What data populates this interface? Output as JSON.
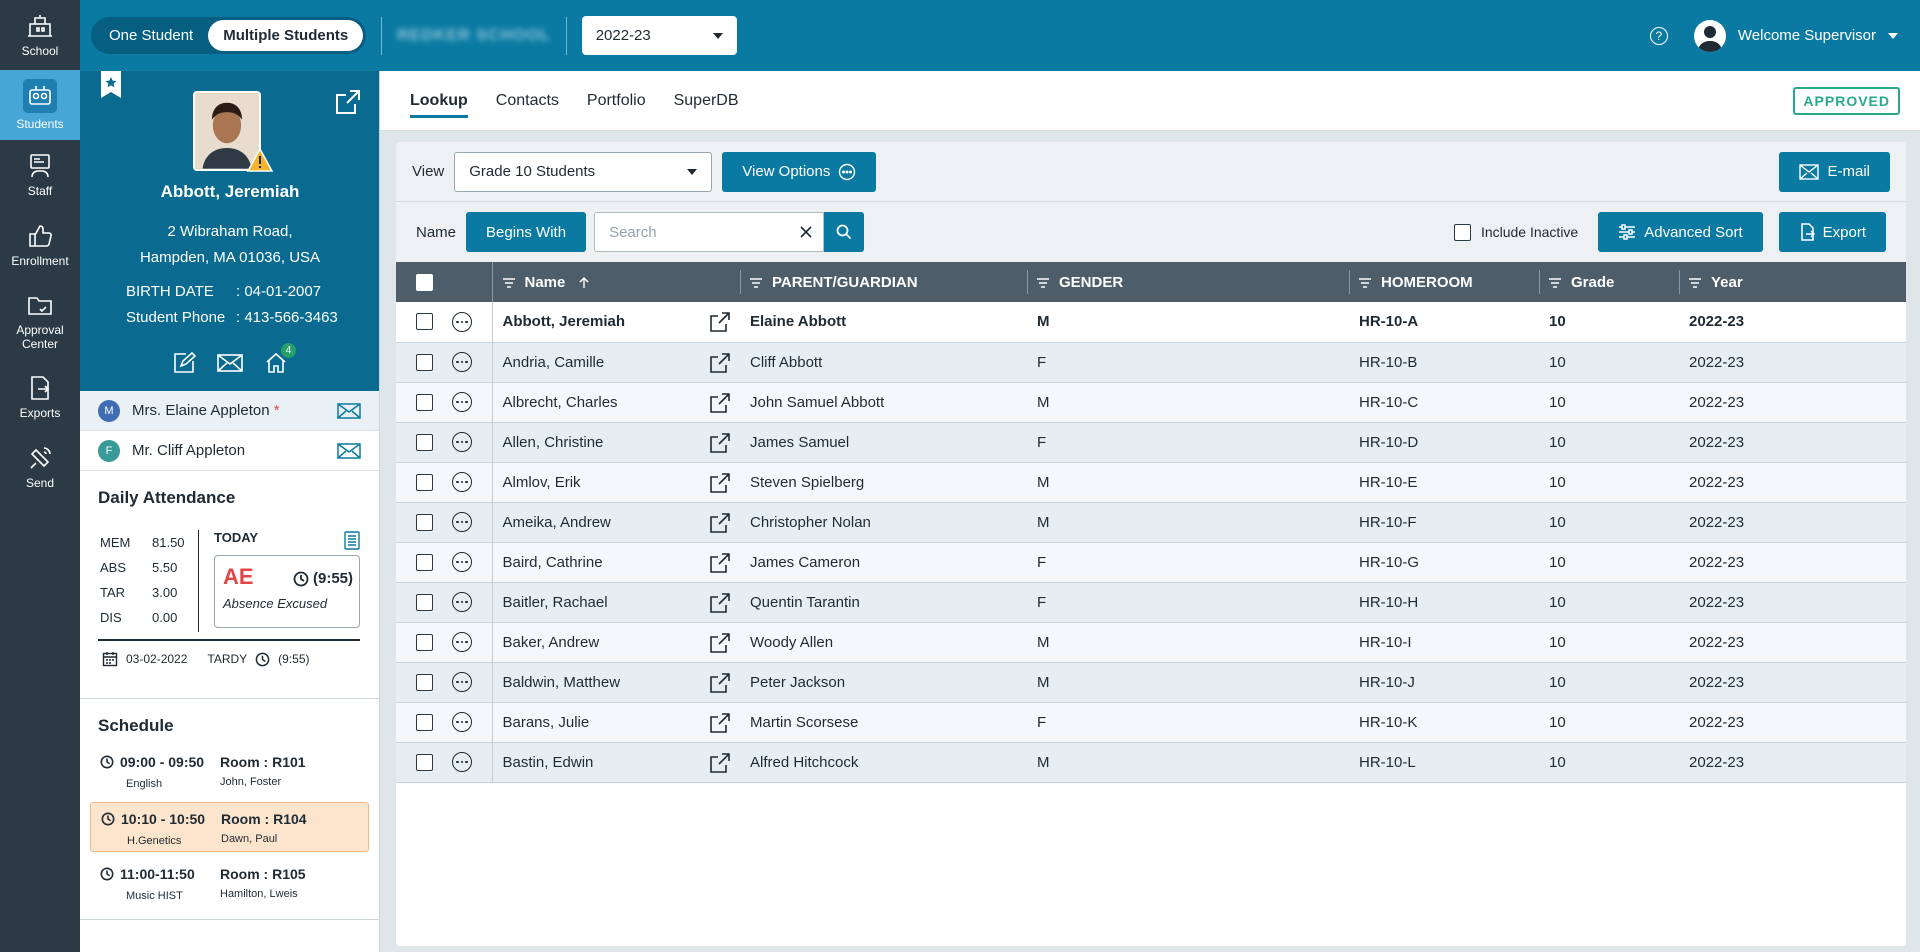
{
  "nav": {
    "items": [
      {
        "label": "School",
        "icon": "school-icon"
      },
      {
        "label": "Students",
        "icon": "students-icon"
      },
      {
        "label": "Staff",
        "icon": "staff-icon"
      },
      {
        "label": "Enrollment",
        "icon": "thumbs-up-icon"
      },
      {
        "label": "Approval Center",
        "icon": "folder-icon"
      },
      {
        "label": "Exports",
        "icon": "export-icon"
      },
      {
        "label": "Send",
        "icon": "satellite-icon"
      }
    ]
  },
  "topbar": {
    "one_student": "One Student",
    "multiple_students": "Multiple Students",
    "school_name": "REDKER SCHOOL",
    "year": "2022-23",
    "welcome": "Welcome Supervisor"
  },
  "student": {
    "name": "Abbott, Jeremiah",
    "address_line1": "2 Wibraham Road,",
    "address_line2": "Hampden, MA 01036, USA",
    "birth_label": "BIRTH DATE",
    "birth_value": ": 04-01-2007",
    "phone_label": "Student Phone",
    "phone_value": ": 413-566-3463",
    "home_badge": "4"
  },
  "guardians": [
    {
      "initial": "M",
      "name": "Mrs. Elaine Appleton",
      "required": "*",
      "color": "#3f6db3"
    },
    {
      "initial": "F",
      "name": "Mr. Cliff Appleton",
      "required": "",
      "color": "#3a9a9a"
    }
  ],
  "attendance": {
    "title": "Daily Attendance",
    "stats": [
      {
        "k": "MEM",
        "v": "81.50"
      },
      {
        "k": "ABS",
        "v": "5.50"
      },
      {
        "k": "TAR",
        "v": "3.00"
      },
      {
        "k": "DIS",
        "v": "0.00"
      }
    ],
    "today_label": "TODAY",
    "code": "AE",
    "time": "(9:55)",
    "description": "Absence Excused",
    "date": "03-02-2022",
    "tardy_label": "TARDY",
    "tardy_time": "(9:55)"
  },
  "schedule": {
    "title": "Schedule",
    "items": [
      {
        "time": "09:00 - 09:50",
        "room": "Room : R101",
        "subject": "English",
        "teacher": "John, Foster",
        "highlight": false
      },
      {
        "time": "10:10 - 10:50",
        "room": "Room : R104",
        "subject": "H.Genetics",
        "teacher": "Dawn, Paul",
        "highlight": true
      },
      {
        "time": "11:00-11:50",
        "room": "Room : R105",
        "subject": "Music HIST",
        "teacher": "Hamilton, Lweis",
        "highlight": false
      }
    ]
  },
  "tabs": [
    "Lookup",
    "Contacts",
    "Portfolio",
    "SuperDB"
  ],
  "status": "APPROVED",
  "toolbar": {
    "view_label": "View",
    "view_value": "Grade 10 Students",
    "view_options": "View Options",
    "email": "E-mail",
    "name_label": "Name",
    "begins_with": "Begins With",
    "search_placeholder": "Search",
    "include_inactive": "Include Inactive",
    "advanced_sort": "Advanced Sort",
    "export": "Export"
  },
  "table": {
    "headers": {
      "name": "Name",
      "parent": "PARENT/GUARDIAN",
      "gender": "GENDER",
      "homeroom": "HOMEROOM",
      "grade": "Grade",
      "year": "Year"
    },
    "rows": [
      {
        "name": "Abbott, Jeremiah",
        "parent": "Elaine Abbott",
        "gender": "M",
        "homeroom": "HR-10-A",
        "grade": "10",
        "year": "2022-23"
      },
      {
        "name": "Andria, Camille",
        "parent": "Cliff Abbott",
        "gender": "F",
        "homeroom": "HR-10-B",
        "grade": "10",
        "year": "2022-23"
      },
      {
        "name": "Albrecht, Charles",
        "parent": "John Samuel Abbott",
        "gender": "M",
        "homeroom": "HR-10-C",
        "grade": "10",
        "year": "2022-23"
      },
      {
        "name": "Allen, Christine",
        "parent": "James Samuel",
        "gender": "F",
        "homeroom": "HR-10-D",
        "grade": "10",
        "year": "2022-23"
      },
      {
        "name": "Almlov, Erik",
        "parent": "Steven Spielberg",
        "gender": "M",
        "homeroom": "HR-10-E",
        "grade": "10",
        "year": "2022-23"
      },
      {
        "name": "Ameika, Andrew",
        "parent": "Christopher Nolan",
        "gender": "M",
        "homeroom": "HR-10-F",
        "grade": "10",
        "year": "2022-23"
      },
      {
        "name": "Baird, Cathrine",
        "parent": "James Cameron",
        "gender": "F",
        "homeroom": "HR-10-G",
        "grade": "10",
        "year": "2022-23"
      },
      {
        "name": "Baitler, Rachael",
        "parent": "Quentin Tarantin",
        "gender": "F",
        "homeroom": "HR-10-H",
        "grade": "10",
        "year": "2022-23"
      },
      {
        "name": "Baker, Andrew",
        "parent": "Woody Allen",
        "gender": "M",
        "homeroom": "HR-10-I",
        "grade": "10",
        "year": "2022-23"
      },
      {
        "name": "Baldwin, Matthew",
        "parent": "Peter Jackson",
        "gender": "M",
        "homeroom": "HR-10-J",
        "grade": "10",
        "year": "2022-23"
      },
      {
        "name": "Barans, Julie",
        "parent": "Martin Scorsese",
        "gender": "F",
        "homeroom": "HR-10-K",
        "grade": "10",
        "year": "2022-23"
      },
      {
        "name": "Bastin, Edwin",
        "parent": "Alfred Hitchcock",
        "gender": "M",
        "homeroom": "HR-10-L",
        "grade": "10",
        "year": "2022-23"
      }
    ]
  }
}
